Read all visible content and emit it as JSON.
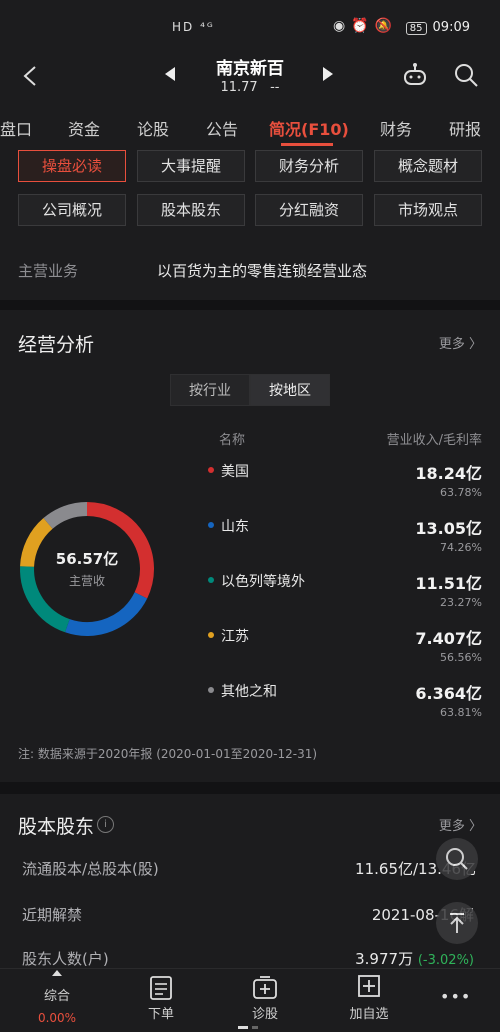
{
  "status": {
    "left_icons": "HD ⁴ᴳ",
    "battery": "85",
    "time": "09:09"
  },
  "nav": {
    "stock_name": "南京新百",
    "price": "11.77",
    "change": "--"
  },
  "tabs": [
    "盘口",
    "资金",
    "论股",
    "公告",
    "简况(F10)",
    "财务",
    "研报"
  ],
  "chips": [
    "操盘必读",
    "大事提醒",
    "财务分析",
    "概念题材",
    "公司概况",
    "股本股东",
    "分红融资",
    "市场观点"
  ],
  "main_business": {
    "label": "主营业务",
    "value": "以百货为主的零售连锁经营业态"
  },
  "analysis": {
    "title": "经营分析",
    "more": "更多 〉",
    "segments": [
      "按行业",
      "按地区"
    ],
    "col_name": "名称",
    "col_value": "营业收入/毛利率",
    "total_value": "56.57亿",
    "total_label": "主营收",
    "note": "注: 数据来源于2020年报 (2020-01-01至2020-12-31)",
    "colors": [
      "#d32f2f",
      "#1565c0",
      "#00897b",
      "#e0a020",
      "#8a8a8e"
    ]
  },
  "chart_data": {
    "type": "pie",
    "categories": [
      "美国",
      "山东",
      "以色列等境外",
      "江苏",
      "其他之和"
    ],
    "values": [
      18.24,
      13.05,
      11.51,
      7.407,
      6.364
    ],
    "value_labels": [
      "18.24亿",
      "13.05亿",
      "11.51亿",
      "7.407亿",
      "6.364亿"
    ],
    "margins": [
      "63.78%",
      "74.26%",
      "23.27%",
      "56.56%",
      "63.81%"
    ],
    "total": "56.57亿"
  },
  "shareholders": {
    "title": "股本股东",
    "info_icon": "i",
    "more": "更多 〉",
    "rows": [
      {
        "key": "流通股本/总股本(股)",
        "value": "11.65亿/13.46亿"
      },
      {
        "key": "近期解禁",
        "value": "2021-08-16解"
      },
      {
        "key": "股东人数(户)",
        "value": "3.977万",
        "change": "(-3.02%)"
      }
    ]
  },
  "bottom": {
    "items": [
      "综合",
      "下单",
      "诊股",
      "加自选",
      "•••"
    ],
    "change": "0.00%"
  }
}
